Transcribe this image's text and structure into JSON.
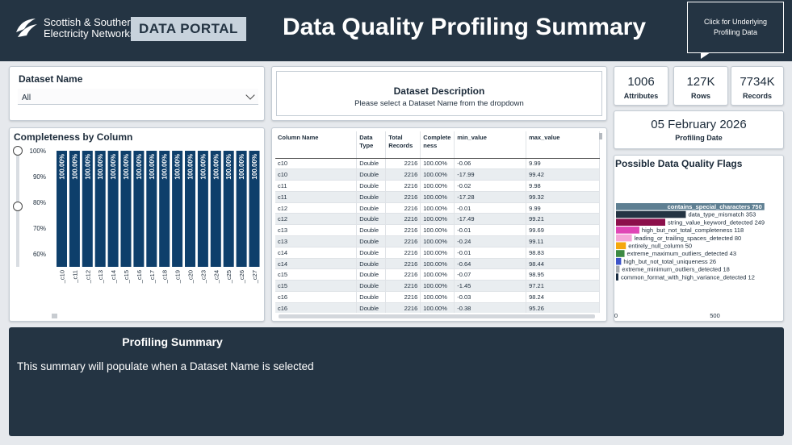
{
  "header": {
    "logo_line1": "Scottish & Southern",
    "logo_line2": "Electricity Networks",
    "portal_label": "DATA PORTAL",
    "title": "Data Quality Profiling Summary",
    "underlying_button": "Click for Underlying Profiling Data",
    "background_color": "#243443"
  },
  "dataset_filter": {
    "title": "Dataset Name",
    "selected": "All"
  },
  "description": {
    "title": "Dataset Description",
    "text": "Please select a Dataset Name from the dropdown"
  },
  "kpis": [
    {
      "value": "1006",
      "label": "Attributes"
    },
    {
      "value": "127K",
      "label": "Rows"
    },
    {
      "value": "7734K",
      "label": "Records"
    }
  ],
  "profiling_date": {
    "value": "05 February 2026",
    "label": "Profiling Date"
  },
  "completeness": {
    "title": "Completeness by Column",
    "bar_color": "#0e3f6b"
  },
  "table": {
    "headers": [
      "Column Name",
      "Data Type",
      "Total Records",
      "Completeness",
      "min_value",
      "max_value"
    ],
    "rows": [
      [
        "c10",
        "Double",
        "2216",
        "100.00%",
        "-0.06",
        "9.99"
      ],
      [
        "c10",
        "Double",
        "2216",
        "100.00%",
        "-17.99",
        "99.42"
      ],
      [
        "c11",
        "Double",
        "2216",
        "100.00%",
        "-0.02",
        "9.98"
      ],
      [
        "c11",
        "Double",
        "2216",
        "100.00%",
        "-17.28",
        "99.32"
      ],
      [
        "c12",
        "Double",
        "2216",
        "100.00%",
        "-0.01",
        "9.99"
      ],
      [
        "c12",
        "Double",
        "2216",
        "100.00%",
        "-17.49",
        "99.21"
      ],
      [
        "c13",
        "Double",
        "2216",
        "100.00%",
        "-0.01",
        "99.69"
      ],
      [
        "c13",
        "Double",
        "2216",
        "100.00%",
        "-0.24",
        "99.11"
      ],
      [
        "c14",
        "Double",
        "2216",
        "100.00%",
        "-0.01",
        "98.83"
      ],
      [
        "c14",
        "Double",
        "2216",
        "100.00%",
        "-0.64",
        "98.44"
      ],
      [
        "c15",
        "Double",
        "2216",
        "100.00%",
        "-0.07",
        "98.95"
      ],
      [
        "c15",
        "Double",
        "2216",
        "100.00%",
        "-1.45",
        "97.21"
      ],
      [
        "c16",
        "Double",
        "2216",
        "100.00%",
        "-0.03",
        "98.24"
      ],
      [
        "c16",
        "Double",
        "2216",
        "100.00%",
        "-0.38",
        "95.26"
      ]
    ]
  },
  "flags": {
    "title": "Possible Data Quality Flags"
  },
  "summary": {
    "title": "Profiling Summary",
    "text": "This summary will populate when a Dataset Name is selected"
  },
  "chart_data": [
    {
      "type": "bar",
      "title": "Completeness by Column",
      "categories": [
        "_c10",
        "_c11",
        "_c12",
        "_c13",
        "_c14",
        "_c15",
        "_c16",
        "_c17",
        "_c18",
        "_c19",
        "_c20",
        "_c23",
        "_c24",
        "_c25",
        "_c26",
        "_c27"
      ],
      "values": [
        100,
        100,
        100,
        100,
        100,
        100,
        100,
        100,
        100,
        100,
        100,
        100,
        100,
        100,
        100,
        100
      ],
      "data_labels": [
        "100.00%",
        "100.00%",
        "100.00%",
        "100.00%",
        "100.00%",
        "100.00%",
        "100.00%",
        "100.00%",
        "100.00%",
        "100.00%",
        "100.00%",
        "100.00%",
        "100.00%",
        "100.00%",
        "100.00%",
        "100.00%"
      ],
      "y_ticks": [
        "60%",
        "70%",
        "80%",
        "90%",
        "100%"
      ],
      "ylim": [
        55,
        100
      ],
      "grid": false,
      "color": "#0e3f6b"
    },
    {
      "type": "bar",
      "orientation": "horizontal",
      "title": "Possible Data Quality Flags",
      "categories": [
        "contains_special_characters",
        "data_type_mismatch",
        "string_value_keyword_detected",
        "high_but_not_total_completeness",
        "leading_or_trailing_spaces_detected",
        "entirely_null_column",
        "extreme_maximum_outliers_detected",
        "high_but_not_total_uniqueness",
        "extreme_minimum_outliers_detected",
        "common_format_with_high_variance_detected"
      ],
      "values": [
        750,
        353,
        249,
        118,
        80,
        50,
        43,
        26,
        18,
        12
      ],
      "colors": [
        "#5e7f92",
        "#243443",
        "#8c0f4b",
        "#e046b6",
        "#f5a6d9",
        "#f5a70e",
        "#3d8a43",
        "#3d54c9",
        "#a5aab0",
        "#162b40"
      ],
      "x_ticks": [
        "0",
        "500"
      ],
      "xlim": [
        0,
        800
      ]
    }
  ]
}
